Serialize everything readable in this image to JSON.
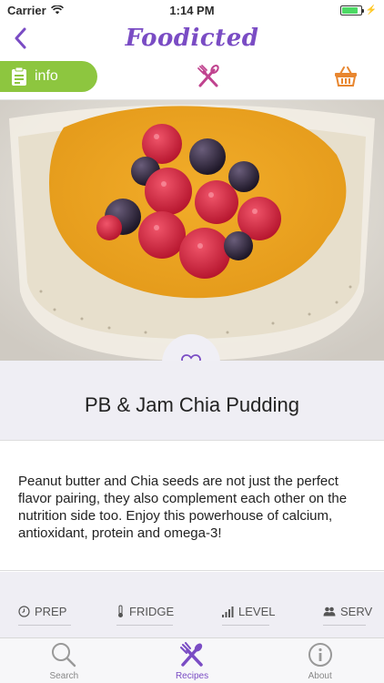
{
  "status_bar": {
    "carrier": "Carrier",
    "time": "1:14 PM"
  },
  "nav": {
    "brand": "Foodicted"
  },
  "tabs_top": {
    "info_label": "info"
  },
  "recipe": {
    "title": "PB & Jam Chia Pudding",
    "description": "Peanut butter and Chia seeds are not just the perfect flavor pairing, they also complement each other on the nutrition side too. Enjoy this powerhouse of calcium, antioxidant, protein and omega-3!"
  },
  "stats": [
    {
      "label": "PREP",
      "icon": "timer-icon"
    },
    {
      "label": "FRIDGE",
      "icon": "thermometer-icon"
    },
    {
      "label": "LEVEL",
      "icon": "level-bars-icon"
    },
    {
      "label": "SERV",
      "icon": "people-icon"
    }
  ],
  "tab_bar": {
    "items": [
      {
        "label": "Search",
        "icon": "search-icon"
      },
      {
        "label": "Recipes",
        "icon": "utensils-icon"
      },
      {
        "label": "About",
        "icon": "info-circle-icon"
      }
    ],
    "active": "Recipes"
  },
  "colors": {
    "accent": "#7a4cc4",
    "info_green": "#8dc63f",
    "basket_orange": "#e8862f",
    "utensils_pink": "#c0438f"
  }
}
